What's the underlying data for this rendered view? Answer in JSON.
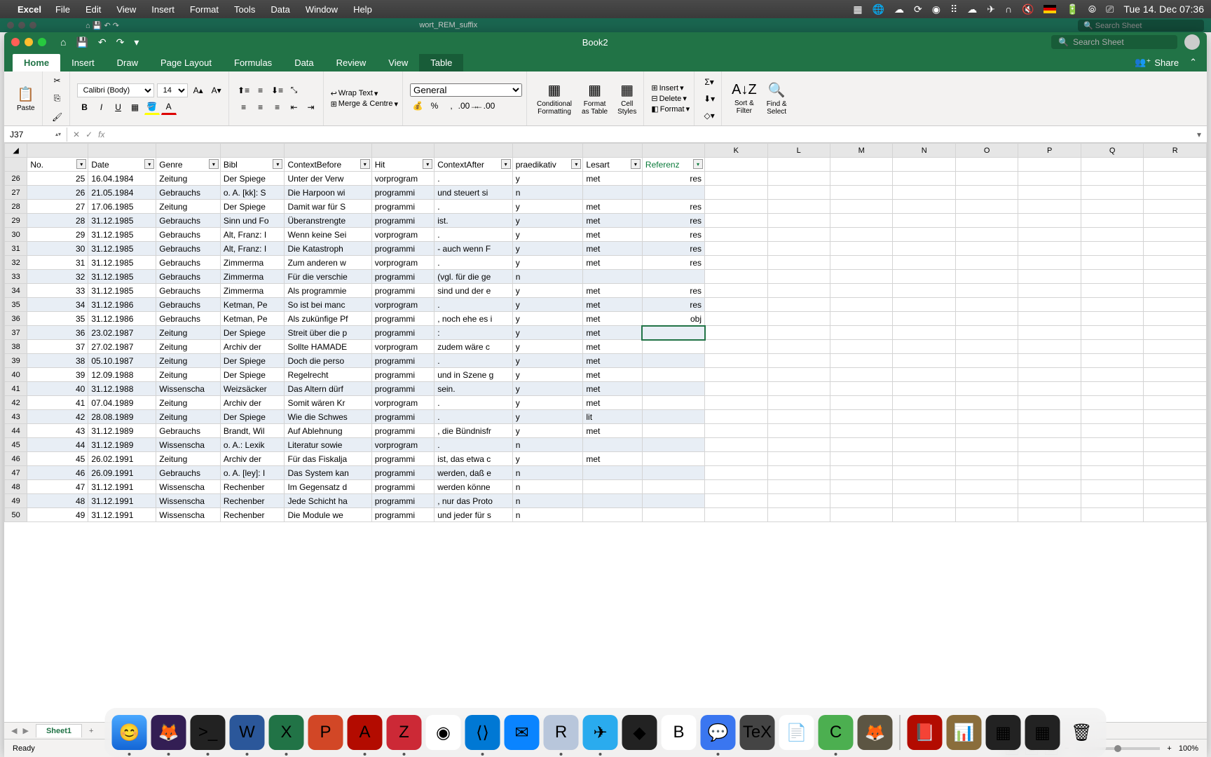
{
  "menubar": {
    "app": "Excel",
    "items": [
      "File",
      "Edit",
      "View",
      "Insert",
      "Format",
      "Tools",
      "Data",
      "Window",
      "Help"
    ],
    "datetime": "Tue 14. Dec  07:36"
  },
  "bg_window": {
    "filename": "wort_REM_suffix",
    "search_placeholder": "Search Sheet"
  },
  "window": {
    "title": "Book2",
    "search_placeholder": "Search Sheet",
    "share": "Share"
  },
  "tabs": [
    "Home",
    "Insert",
    "Draw",
    "Page Layout",
    "Formulas",
    "Data",
    "Review",
    "View",
    "Table"
  ],
  "active_tab": "Home",
  "ribbon": {
    "paste": "Paste",
    "font_name": "Calibri (Body)",
    "font_size": "14",
    "wrap": "Wrap Text",
    "merge": "Merge & Centre",
    "numformat": "General",
    "cond": "Conditional\nFormatting",
    "fmttable": "Format\nas Table",
    "cellstyles": "Cell\nStyles",
    "insert": "Insert",
    "delete": "Delete",
    "format": "Format",
    "sort": "Sort &\nFilter",
    "find": "Find &\nSelect"
  },
  "namebox": "J37",
  "columns_letters": [
    "",
    "",
    "",
    "",
    "",
    "",
    "",
    "",
    "",
    "",
    "K",
    "L",
    "M",
    "N",
    "O",
    "P",
    "Q",
    "R"
  ],
  "headers": [
    "No.",
    "Date",
    "Genre",
    "Bibl",
    "ContextBefore",
    "Hit",
    "ContextAfter",
    "praedikativ",
    "Lesart",
    "Referenz"
  ],
  "rows": [
    {
      "rn": 26,
      "no": 25,
      "date": "16.04.1984",
      "genre": "Zeitung",
      "bibl": "Der Spiege",
      "ctx": "Unter der Verw",
      "hit": "vorprogram",
      "ctxa": ".",
      "pr": "y",
      "les": "met",
      "ref": "res"
    },
    {
      "rn": 27,
      "no": 26,
      "date": "21.05.1984",
      "genre": "Gebrauchs",
      "bibl": "o. A. [kk]: S",
      "ctx": "Die Harpoon wi",
      "hit": "programmi",
      "ctxa": "und steuert si",
      "pr": "n",
      "les": "",
      "ref": ""
    },
    {
      "rn": 28,
      "no": 27,
      "date": "17.06.1985",
      "genre": "Zeitung",
      "bibl": "Der Spiege",
      "ctx": "Damit war für S",
      "hit": "programmi",
      "ctxa": ".",
      "pr": "y",
      "les": "met",
      "ref": "res"
    },
    {
      "rn": 29,
      "no": 28,
      "date": "31.12.1985",
      "genre": "Gebrauchs",
      "bibl": "Sinn und Fo",
      "ctx": "Überanstrengte",
      "hit": "programmi",
      "ctxa": "ist.",
      "pr": "y",
      "les": "met",
      "ref": "res"
    },
    {
      "rn": 30,
      "no": 29,
      "date": "31.12.1985",
      "genre": "Gebrauchs",
      "bibl": "Alt, Franz: I",
      "ctx": "Wenn keine Sei",
      "hit": "vorprogram",
      "ctxa": ".",
      "pr": "y",
      "les": "met",
      "ref": "res"
    },
    {
      "rn": 31,
      "no": 30,
      "date": "31.12.1985",
      "genre": "Gebrauchs",
      "bibl": "Alt, Franz: I",
      "ctx": "Die Katastroph",
      "hit": "programmi",
      "ctxa": "- auch wenn F",
      "pr": "y",
      "les": "met",
      "ref": "res"
    },
    {
      "rn": 32,
      "no": 31,
      "date": "31.12.1985",
      "genre": "Gebrauchs",
      "bibl": "Zimmerma",
      "ctx": "Zum anderen w",
      "hit": "vorprogram",
      "ctxa": ".",
      "pr": "y",
      "les": "met",
      "ref": "res"
    },
    {
      "rn": 33,
      "no": 32,
      "date": "31.12.1985",
      "genre": "Gebrauchs",
      "bibl": "Zimmerma",
      "ctx": "Für die verschie",
      "hit": "programmi",
      "ctxa": "(vgl. für die ge",
      "pr": "n",
      "les": "",
      "ref": ""
    },
    {
      "rn": 34,
      "no": 33,
      "date": "31.12.1985",
      "genre": "Gebrauchs",
      "bibl": "Zimmerma",
      "ctx": "Als programmie",
      "hit": "programmi",
      "ctxa": "sind und der e",
      "pr": "y",
      "les": "met",
      "ref": "res"
    },
    {
      "rn": 35,
      "no": 34,
      "date": "31.12.1986",
      "genre": "Gebrauchs",
      "bibl": "Ketman, Pe",
      "ctx": "So ist bei manc",
      "hit": "vorprogram",
      "ctxa": ".",
      "pr": "y",
      "les": "met",
      "ref": "res"
    },
    {
      "rn": 36,
      "no": 35,
      "date": "31.12.1986",
      "genre": "Gebrauchs",
      "bibl": "Ketman, Pe",
      "ctx": "Als zukünfige Pf",
      "hit": "programmi",
      "ctxa": ", noch ehe es i",
      "pr": "y",
      "les": "met",
      "ref": "obj"
    },
    {
      "rn": 37,
      "no": 36,
      "date": "23.02.1987",
      "genre": "Zeitung",
      "bibl": "Der Spiege",
      "ctx": "Streit über die p",
      "hit": "programmi",
      "ctxa": ":",
      "pr": "y",
      "les": "met",
      "ref": ""
    },
    {
      "rn": 38,
      "no": 37,
      "date": "27.02.1987",
      "genre": "Zeitung",
      "bibl": "Archiv der",
      "ctx": "Sollte HAMADE",
      "hit": "vorprogram",
      "ctxa": "zudem wäre c",
      "pr": "y",
      "les": "met",
      "ref": ""
    },
    {
      "rn": 39,
      "no": 38,
      "date": "05.10.1987",
      "genre": "Zeitung",
      "bibl": "Der Spiege",
      "ctx": "Doch die perso",
      "hit": "programmi",
      "ctxa": ".",
      "pr": "y",
      "les": "met",
      "ref": ""
    },
    {
      "rn": 40,
      "no": 39,
      "date": "12.09.1988",
      "genre": "Zeitung",
      "bibl": "Der Spiege",
      "ctx": "Regelrecht",
      "hit": "programmi",
      "ctxa": "und in Szene g",
      "pr": "y",
      "les": "met",
      "ref": ""
    },
    {
      "rn": 41,
      "no": 40,
      "date": "31.12.1988",
      "genre": "Wissenscha",
      "bibl": "Weizsäcker",
      "ctx": "Das Altern dürf",
      "hit": "programmi",
      "ctxa": "sein.",
      "pr": "y",
      "les": "met",
      "ref": ""
    },
    {
      "rn": 42,
      "no": 41,
      "date": "07.04.1989",
      "genre": "Zeitung",
      "bibl": "Archiv der",
      "ctx": "Somit wären Kr",
      "hit": "vorprogram",
      "ctxa": ".",
      "pr": "y",
      "les": "met",
      "ref": ""
    },
    {
      "rn": 43,
      "no": 42,
      "date": "28.08.1989",
      "genre": "Zeitung",
      "bibl": "Der Spiege",
      "ctx": "Wie die Schwes",
      "hit": "programmi",
      "ctxa": ".",
      "pr": "y",
      "les": "lit",
      "ref": ""
    },
    {
      "rn": 44,
      "no": 43,
      "date": "31.12.1989",
      "genre": "Gebrauchs",
      "bibl": "Brandt, Wil",
      "ctx": "Auf Ablehnung",
      "hit": "programmi",
      "ctxa": ", die Bündnisfr",
      "pr": "y",
      "les": "met",
      "ref": ""
    },
    {
      "rn": 45,
      "no": 44,
      "date": "31.12.1989",
      "genre": "Wissenscha",
      "bibl": "o. A.: Lexik",
      "ctx": "Literatur sowie",
      "hit": "vorprogram",
      "ctxa": ".",
      "pr": "n",
      "les": "",
      "ref": ""
    },
    {
      "rn": 46,
      "no": 45,
      "date": "26.02.1991",
      "genre": "Zeitung",
      "bibl": "Archiv der",
      "ctx": "Für das Fiskalja",
      "hit": "programmi",
      "ctxa": "ist, das etwa c",
      "pr": "y",
      "les": "met",
      "ref": ""
    },
    {
      "rn": 47,
      "no": 46,
      "date": "26.09.1991",
      "genre": "Gebrauchs",
      "bibl": "o. A. [ley]: I",
      "ctx": "Das System kan",
      "hit": "programmi",
      "ctxa": "werden, daß e",
      "pr": "n",
      "les": "",
      "ref": ""
    },
    {
      "rn": 48,
      "no": 47,
      "date": "31.12.1991",
      "genre": "Wissenscha",
      "bibl": "Rechenber",
      "ctx": "Im Gegensatz d",
      "hit": "programmi",
      "ctxa": "werden könne",
      "pr": "n",
      "les": "",
      "ref": ""
    },
    {
      "rn": 49,
      "no": 48,
      "date": "31.12.1991",
      "genre": "Wissenscha",
      "bibl": "Rechenber",
      "ctx": "Jede Schicht ha",
      "hit": "programmi",
      "ctxa": ", nur das Proto",
      "pr": "n",
      "les": "",
      "ref": ""
    },
    {
      "rn": 50,
      "no": 49,
      "date": "31.12.1991",
      "genre": "Wissenscha",
      "bibl": "Rechenber",
      "ctx": "Die Module we",
      "hit": "programmi",
      "ctxa": "und jeder für s",
      "pr": "n",
      "les": "",
      "ref": ""
    }
  ],
  "sheet": "Sheet1",
  "status": "Ready",
  "zoom": "100%"
}
